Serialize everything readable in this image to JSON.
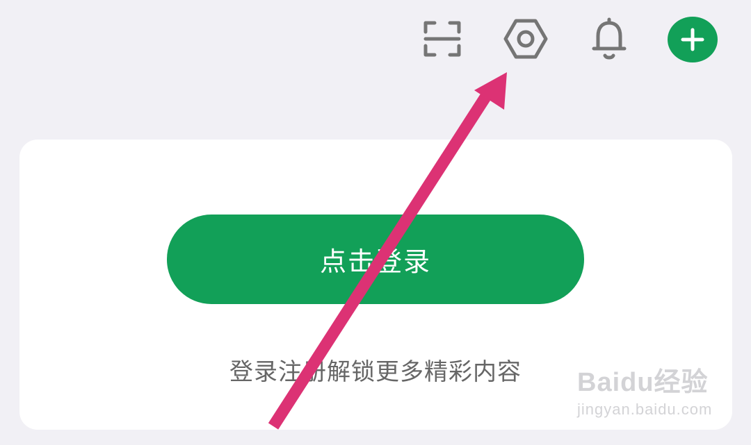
{
  "topbar": {
    "icons": [
      {
        "name": "scan-icon"
      },
      {
        "name": "settings-icon"
      },
      {
        "name": "notifications-bell-icon"
      },
      {
        "name": "add-plus-icon"
      }
    ],
    "colors": {
      "icon_gray": "#757575",
      "accent_green": "#12a058"
    }
  },
  "main": {
    "login_button_label": "点击登录",
    "hint_text": "登录注册解锁更多精彩内容"
  },
  "overlay": {
    "arrow_color": "#dc3274"
  },
  "watermark": {
    "brand": "Baidu经验",
    "url": "jingyan.baidu.com"
  }
}
